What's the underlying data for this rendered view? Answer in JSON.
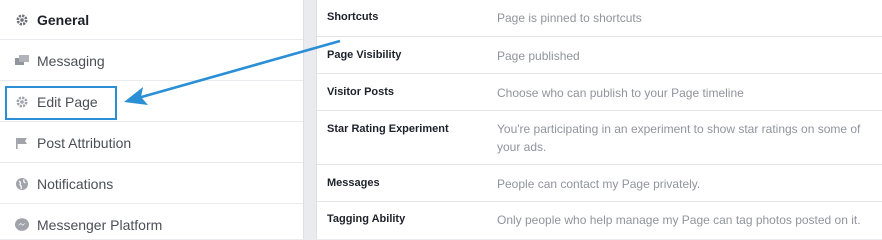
{
  "sidebar": {
    "items": [
      {
        "label": "General",
        "icon": "gear-icon",
        "active": true
      },
      {
        "label": "Messaging",
        "icon": "messaging-icon",
        "active": false
      },
      {
        "label": "Edit Page",
        "icon": "gear-icon",
        "active": false,
        "highlighted": true
      },
      {
        "label": "Post Attribution",
        "icon": "flag-icon",
        "active": false
      },
      {
        "label": "Notifications",
        "icon": "globe-icon",
        "active": false
      },
      {
        "label": "Messenger Platform",
        "icon": "messenger-icon",
        "active": false
      }
    ]
  },
  "settings": {
    "rows": [
      {
        "label": "Shortcuts",
        "value": "Page is pinned to shortcuts"
      },
      {
        "label": "Page Visibility",
        "value": "Page published"
      },
      {
        "label": "Visitor Posts",
        "value": "Choose who can publish to your Page timeline"
      },
      {
        "label": "Star Rating Experiment",
        "value": "You're participating in an experiment to show star ratings on some of your ads."
      },
      {
        "label": "Messages",
        "value": "People can contact my Page privately."
      },
      {
        "label": "Tagging Ability",
        "value": "Only people who help manage my Page can tag photos posted on it."
      }
    ]
  },
  "annotation": {
    "color": "#2b8fd6"
  }
}
